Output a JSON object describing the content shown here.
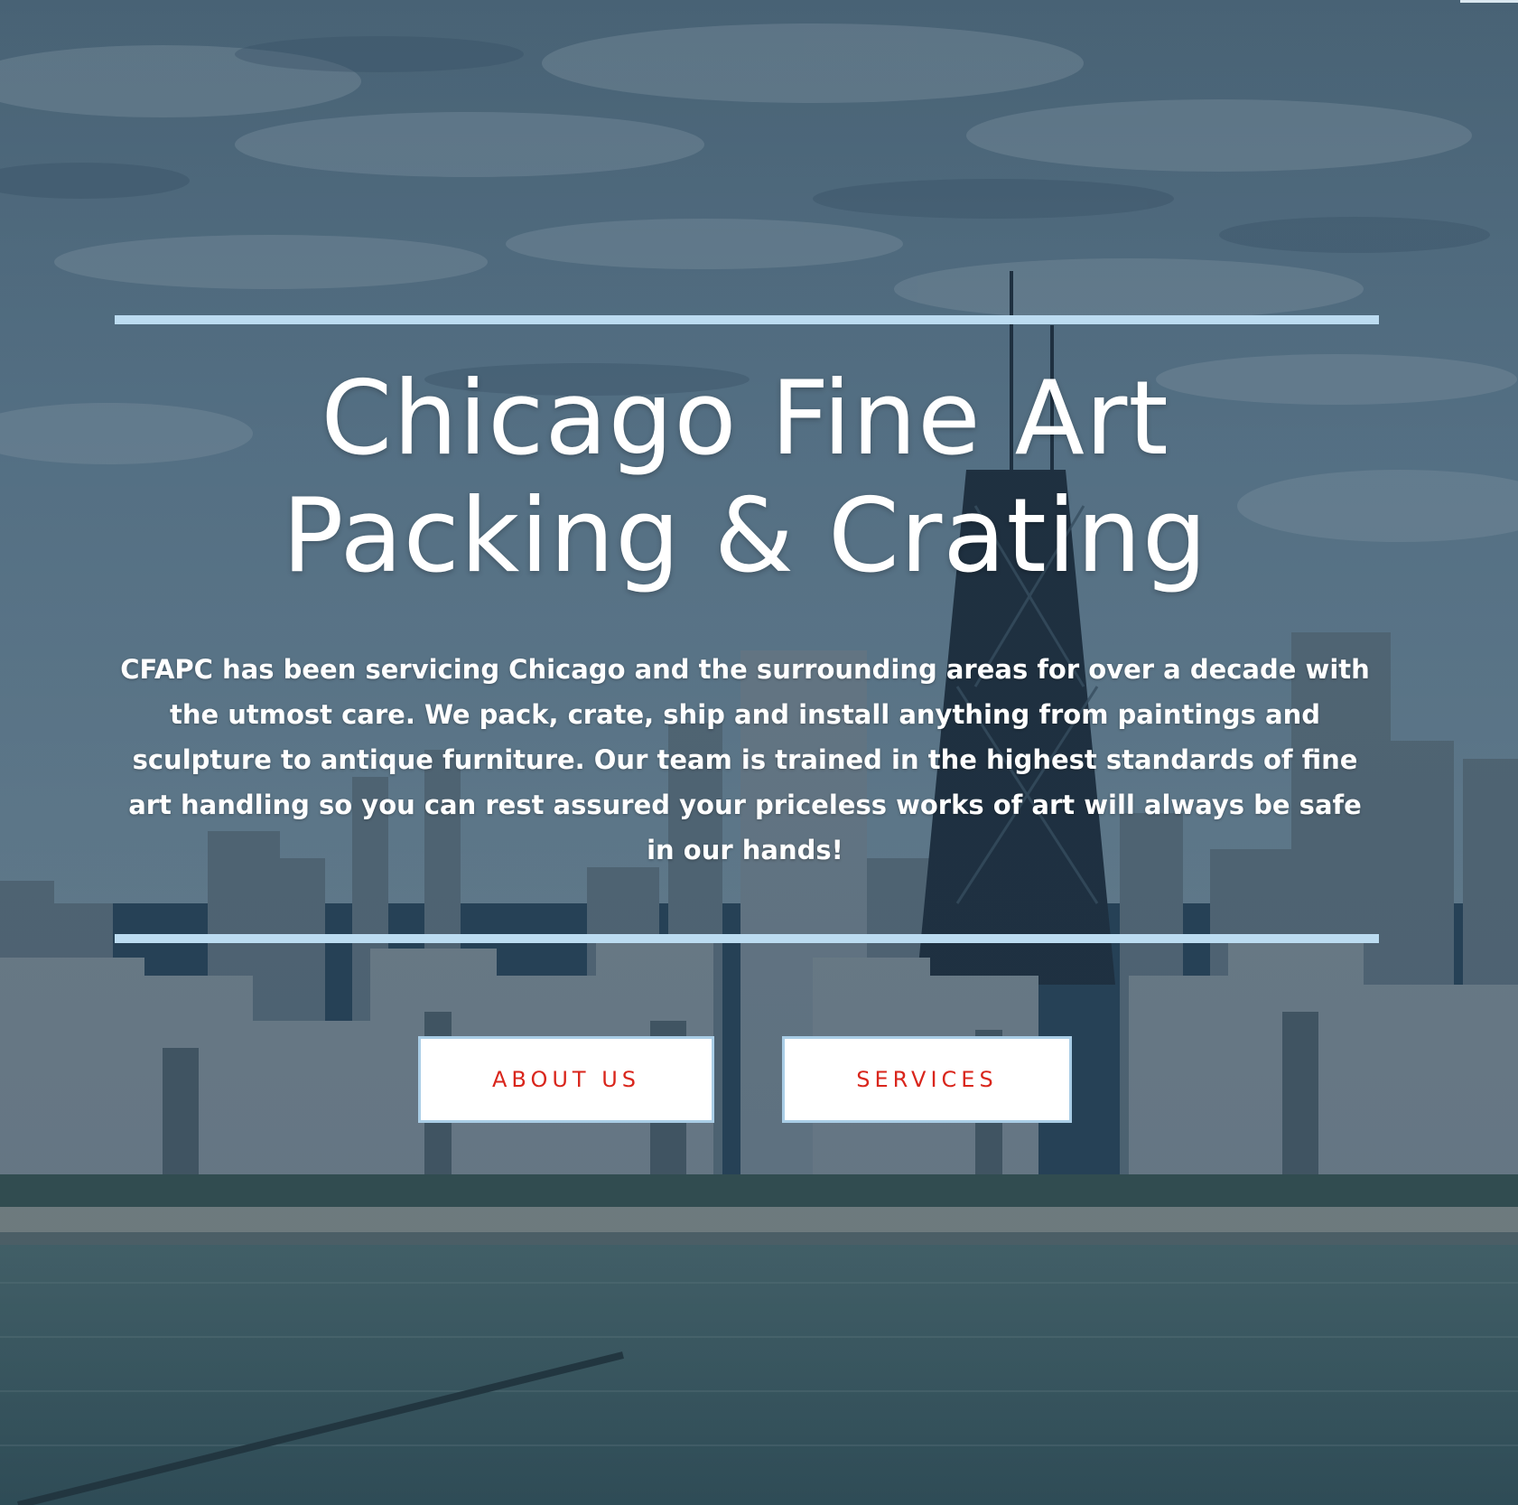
{
  "hero": {
    "title_line_1": "Chicago Fine Art",
    "title_line_2": "Packing & Crating",
    "description": "CFAPC has been servicing Chicago and the surrounding areas for over a decade with the utmost care. We pack, crate, ship and install anything from paintings and sculpture to antique furniture. Our team is trained in the highest standards of fine art handling so you can rest assured your priceless works of art will always be safe in our hands!"
  },
  "buttons": {
    "about_label": "ABOUT US",
    "services_label": "SERVICES"
  },
  "colors": {
    "accent_rule": "#bcdcf1",
    "button_text": "#d9261c",
    "button_border": "#a9cde6",
    "overlay": "#1e3a55"
  }
}
